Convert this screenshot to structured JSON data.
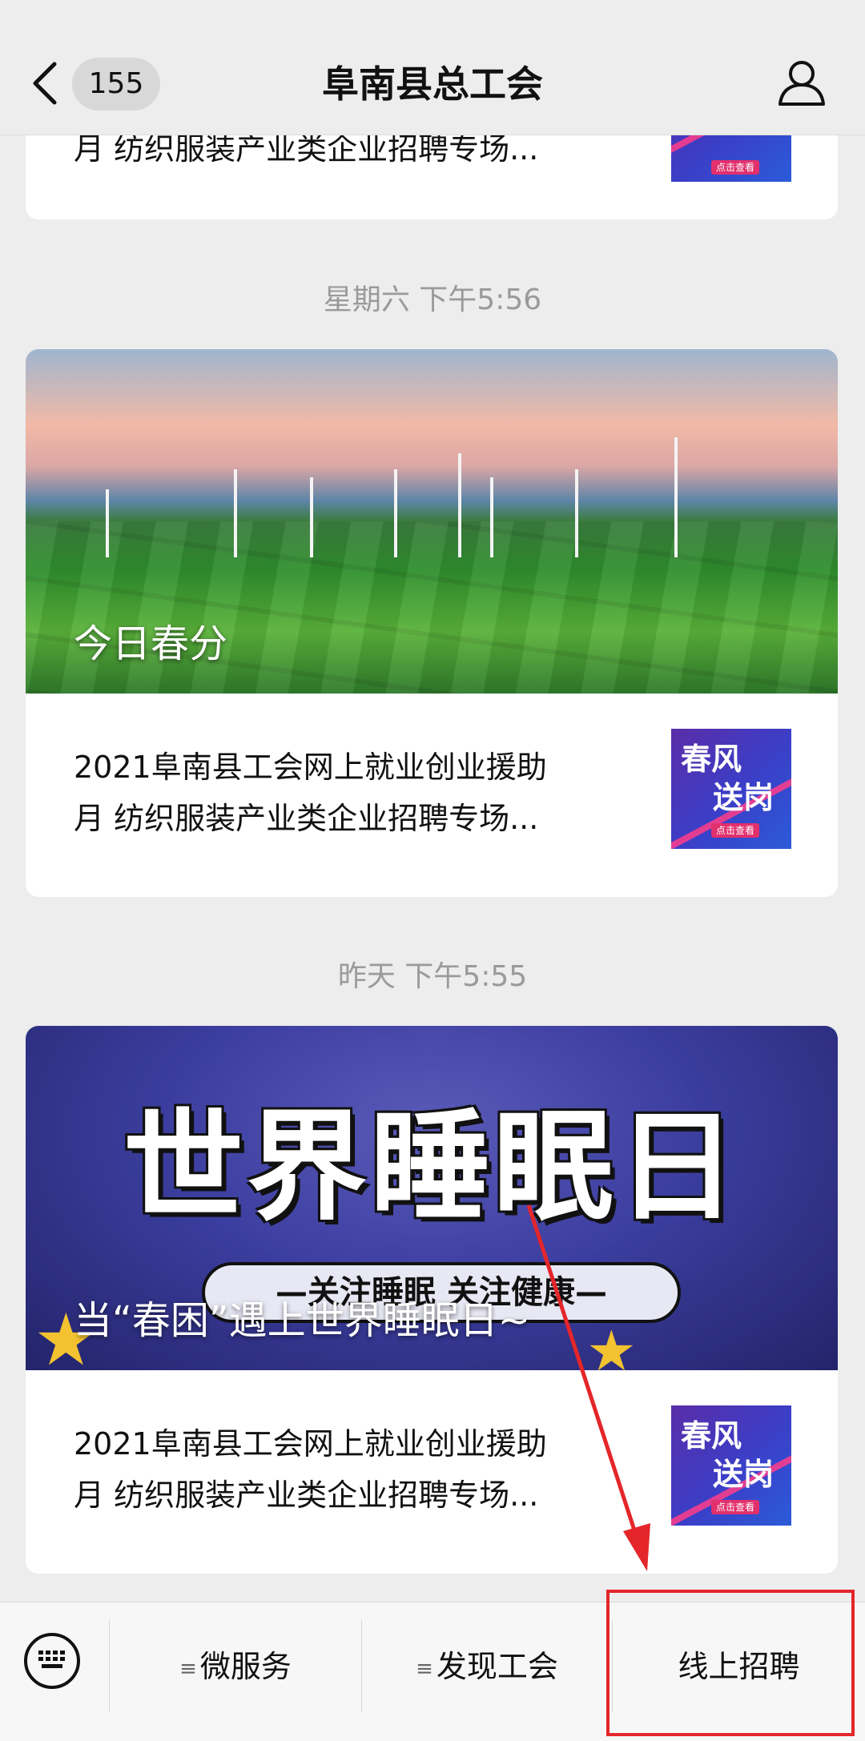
{
  "header": {
    "back_count": "155",
    "title": "阜南县总工会"
  },
  "feed": {
    "partial_card": {
      "line2": "月 纺织服装产业类企业招聘专场..."
    },
    "groups": [
      {
        "timestamp": "星期六 下午5:56",
        "cover_title": "今日春分",
        "sub_line1": "2021阜南县工会网上就业创业援助",
        "sub_line2": "月 纺织服装产业类企业招聘专场...",
        "thumb_top": "春风",
        "thumb_bottom": "送岗",
        "thumb_tag": "点击查看"
      },
      {
        "timestamp": "昨天 下午5:55",
        "cover_art_big": "世界睡眠日",
        "cover_art_pill": "—关注睡眠 关注健康—",
        "cover_title": "当“春困”遇上世界睡眠日~",
        "sub_line1": "2021阜南县工会网上就业创业援助",
        "sub_line2": "月 纺织服装产业类企业招聘专场...",
        "thumb_top": "春风",
        "thumb_bottom": "送岗",
        "thumb_tag": "点击查看"
      }
    ]
  },
  "bottom_menu": {
    "items": [
      {
        "label": "微服务",
        "glyph": "≡"
      },
      {
        "label": "发现工会",
        "glyph": "≡"
      },
      {
        "label": "线上招聘"
      }
    ]
  },
  "icons": {
    "back": "chevron-left-icon",
    "profile": "person-icon",
    "keyboard": "keyboard-icon"
  },
  "colors": {
    "background": "#ededed",
    "annotation": "#e4262a",
    "thumb_gradient": [
      "#5a2da8",
      "#2b5bd8"
    ]
  }
}
